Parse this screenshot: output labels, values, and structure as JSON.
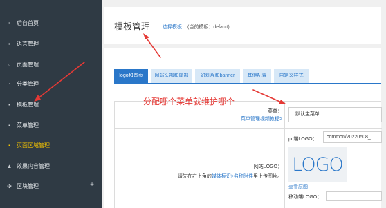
{
  "sidebar": {
    "items": [
      {
        "label": "后台首页",
        "icon": "home-icon"
      },
      {
        "label": "语言管理",
        "icon": "language-icon"
      },
      {
        "label": "页面管理",
        "icon": "page-icon"
      },
      {
        "label": "分类管理",
        "icon": "category-icon"
      },
      {
        "label": "模板管理",
        "icon": "template-icon"
      },
      {
        "label": "菜单管理",
        "icon": "menu-icon"
      },
      {
        "label": "页面区域管理",
        "icon": "area-icon",
        "active": true
      },
      {
        "label": "效果内容管理",
        "icon": "effect-icon"
      },
      {
        "label": "区块管理",
        "icon": "block-icon",
        "expand": "+"
      }
    ]
  },
  "header": {
    "title": "模板管理",
    "select_link": "选择模板",
    "current_template": "(当前模板：default)"
  },
  "tabs": [
    {
      "label": "logo和首页",
      "active": true
    },
    {
      "label": "网站头部和尾部"
    },
    {
      "label": "幻灯片和banner"
    },
    {
      "label": "其他配置"
    },
    {
      "label": "自定义样式"
    }
  ],
  "form": {
    "menu_label": "菜单：",
    "menu_help": "菜单管理视频教程>",
    "menu_select_value": "默认主菜单",
    "logo_label": "网站LOGO：",
    "logo_desc_prefix": "请先在右上角的",
    "logo_desc_link1": "媒体标识>",
    "logo_desc_link2": "名称附件",
    "logo_desc_suffix": "里上传图片。",
    "pc_logo_label": "pc端LOGO：",
    "pc_logo_value": "common/20220508_",
    "logo_preview_text": "LOGO",
    "view_original": "查看原图",
    "mobile_logo_label": "移动端LOGO："
  },
  "annotation": {
    "text": "分配哪个菜单就维护哪个",
    "color": "#e53935"
  },
  "colors": {
    "sidebar_bg": "#2f3a44",
    "active_nav": "#f5c400",
    "accent": "#2a77c9"
  }
}
